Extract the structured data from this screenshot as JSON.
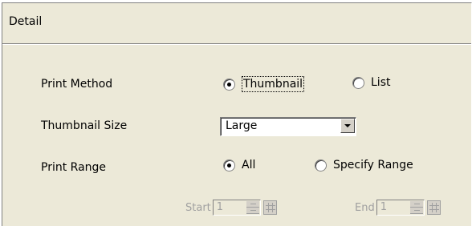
{
  "panel": {
    "title": "Detail"
  },
  "print_method": {
    "label": "Print Method",
    "options": [
      {
        "label": "Thumbnail",
        "selected": true
      },
      {
        "label": "List",
        "selected": false
      }
    ]
  },
  "thumbnail_size": {
    "label": "Thumbnail Size",
    "value": "Large"
  },
  "print_range": {
    "label": "Print Range",
    "options": [
      {
        "label": "All",
        "selected": true
      },
      {
        "label": "Specify Range",
        "selected": false
      }
    ],
    "start": {
      "label": "Start",
      "value": "1"
    },
    "end": {
      "label": "End",
      "value": "1"
    }
  },
  "colors": {
    "panel_bg": "#ece9d8",
    "disabled_text": "#a0a0a0"
  },
  "icons": {
    "spin": "spin-arrows-icon",
    "grid": "grid-icon",
    "dropdown": "chevron-down-icon"
  }
}
